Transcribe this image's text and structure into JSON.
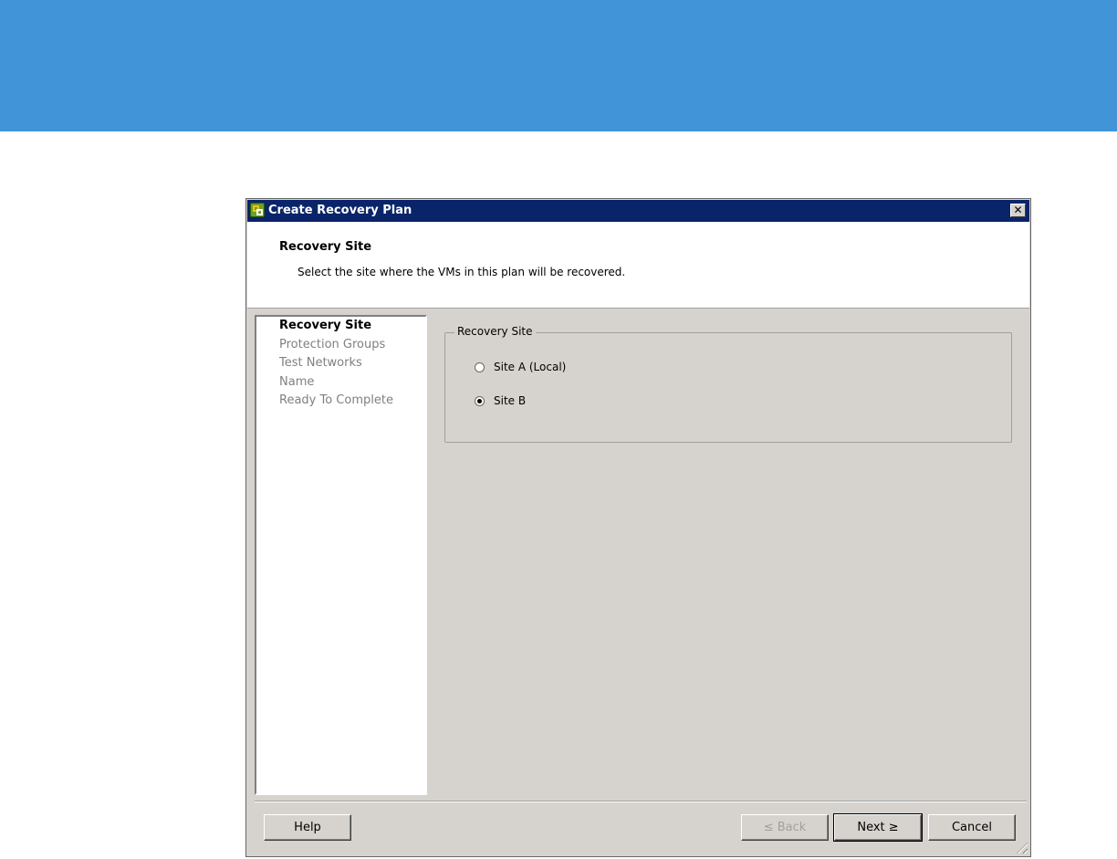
{
  "dialog": {
    "title": "Create Recovery Plan",
    "close_label": "✕",
    "header": {
      "title": "Recovery Site",
      "description": "Select the site where the VMs in this plan will be recovered."
    },
    "steps": [
      {
        "label": "Recovery Site",
        "active": true
      },
      {
        "label": "Protection Groups",
        "active": false
      },
      {
        "label": "Test Networks",
        "active": false
      },
      {
        "label": "Name",
        "active": false
      },
      {
        "label": "Ready To Complete",
        "active": false
      }
    ],
    "group": {
      "legend": "Recovery Site",
      "options": [
        {
          "label": "Site A (Local)",
          "selected": false
        },
        {
          "label": "Site B",
          "selected": true
        }
      ]
    },
    "buttons": {
      "help": "Help",
      "back": "≤ Back",
      "next": "Next ≥",
      "cancel": "Cancel"
    }
  },
  "colors": {
    "banner": "#4194d8",
    "titlebar": "#0a246a",
    "dialog_bg": "#d6d3ce"
  },
  "icons": [
    "app-icon",
    "close-icon",
    "resize-grip-icon"
  ]
}
